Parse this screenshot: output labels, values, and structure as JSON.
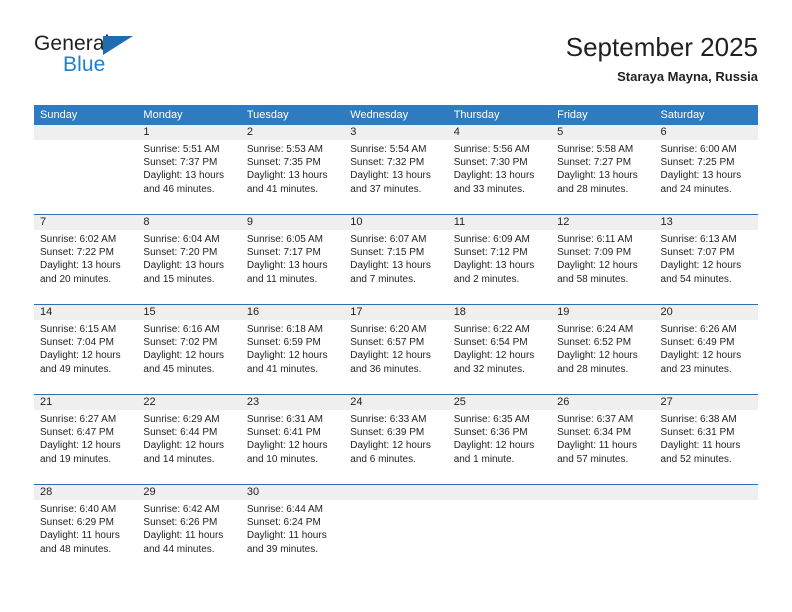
{
  "brand": {
    "name_part1": "General",
    "name_part2": "Blue",
    "flag_icon": "triangle-flag-icon"
  },
  "header": {
    "title": "September 2025",
    "location": "Staraya Mayna, Russia"
  },
  "theme": {
    "header_blue": "#2f7bbf",
    "row_rule_blue": "#2f6fab",
    "daynum_band": "#efefef",
    "brand_blue": "#1f7fd0",
    "text": "#231f20",
    "background": "#ffffff"
  },
  "weekdays": [
    "Sunday",
    "Monday",
    "Tuesday",
    "Wednesday",
    "Thursday",
    "Friday",
    "Saturday"
  ],
  "weeks": [
    [
      {
        "day": "",
        "lines": [
          "",
          "",
          "",
          ""
        ],
        "empty": true
      },
      {
        "day": "1",
        "lines": [
          "Sunrise: 5:51 AM",
          "Sunset: 7:37 PM",
          "Daylight: 13 hours",
          "and 46 minutes."
        ]
      },
      {
        "day": "2",
        "lines": [
          "Sunrise: 5:53 AM",
          "Sunset: 7:35 PM",
          "Daylight: 13 hours",
          "and 41 minutes."
        ]
      },
      {
        "day": "3",
        "lines": [
          "Sunrise: 5:54 AM",
          "Sunset: 7:32 PM",
          "Daylight: 13 hours",
          "and 37 minutes."
        ]
      },
      {
        "day": "4",
        "lines": [
          "Sunrise: 5:56 AM",
          "Sunset: 7:30 PM",
          "Daylight: 13 hours",
          "and 33 minutes."
        ]
      },
      {
        "day": "5",
        "lines": [
          "Sunrise: 5:58 AM",
          "Sunset: 7:27 PM",
          "Daylight: 13 hours",
          "and 28 minutes."
        ]
      },
      {
        "day": "6",
        "lines": [
          "Sunrise: 6:00 AM",
          "Sunset: 7:25 PM",
          "Daylight: 13 hours",
          "and 24 minutes."
        ]
      }
    ],
    [
      {
        "day": "7",
        "lines": [
          "Sunrise: 6:02 AM",
          "Sunset: 7:22 PM",
          "Daylight: 13 hours",
          "and 20 minutes."
        ]
      },
      {
        "day": "8",
        "lines": [
          "Sunrise: 6:04 AM",
          "Sunset: 7:20 PM",
          "Daylight: 13 hours",
          "and 15 minutes."
        ]
      },
      {
        "day": "9",
        "lines": [
          "Sunrise: 6:05 AM",
          "Sunset: 7:17 PM",
          "Daylight: 13 hours",
          "and 11 minutes."
        ]
      },
      {
        "day": "10",
        "lines": [
          "Sunrise: 6:07 AM",
          "Sunset: 7:15 PM",
          "Daylight: 13 hours",
          "and 7 minutes."
        ]
      },
      {
        "day": "11",
        "lines": [
          "Sunrise: 6:09 AM",
          "Sunset: 7:12 PM",
          "Daylight: 13 hours",
          "and 2 minutes."
        ]
      },
      {
        "day": "12",
        "lines": [
          "Sunrise: 6:11 AM",
          "Sunset: 7:09 PM",
          "Daylight: 12 hours",
          "and 58 minutes."
        ]
      },
      {
        "day": "13",
        "lines": [
          "Sunrise: 6:13 AM",
          "Sunset: 7:07 PM",
          "Daylight: 12 hours",
          "and 54 minutes."
        ]
      }
    ],
    [
      {
        "day": "14",
        "lines": [
          "Sunrise: 6:15 AM",
          "Sunset: 7:04 PM",
          "Daylight: 12 hours",
          "and 49 minutes."
        ]
      },
      {
        "day": "15",
        "lines": [
          "Sunrise: 6:16 AM",
          "Sunset: 7:02 PM",
          "Daylight: 12 hours",
          "and 45 minutes."
        ]
      },
      {
        "day": "16",
        "lines": [
          "Sunrise: 6:18 AM",
          "Sunset: 6:59 PM",
          "Daylight: 12 hours",
          "and 41 minutes."
        ]
      },
      {
        "day": "17",
        "lines": [
          "Sunrise: 6:20 AM",
          "Sunset: 6:57 PM",
          "Daylight: 12 hours",
          "and 36 minutes."
        ]
      },
      {
        "day": "18",
        "lines": [
          "Sunrise: 6:22 AM",
          "Sunset: 6:54 PM",
          "Daylight: 12 hours",
          "and 32 minutes."
        ]
      },
      {
        "day": "19",
        "lines": [
          "Sunrise: 6:24 AM",
          "Sunset: 6:52 PM",
          "Daylight: 12 hours",
          "and 28 minutes."
        ]
      },
      {
        "day": "20",
        "lines": [
          "Sunrise: 6:26 AM",
          "Sunset: 6:49 PM",
          "Daylight: 12 hours",
          "and 23 minutes."
        ]
      }
    ],
    [
      {
        "day": "21",
        "lines": [
          "Sunrise: 6:27 AM",
          "Sunset: 6:47 PM",
          "Daylight: 12 hours",
          "and 19 minutes."
        ]
      },
      {
        "day": "22",
        "lines": [
          "Sunrise: 6:29 AM",
          "Sunset: 6:44 PM",
          "Daylight: 12 hours",
          "and 14 minutes."
        ]
      },
      {
        "day": "23",
        "lines": [
          "Sunrise: 6:31 AM",
          "Sunset: 6:41 PM",
          "Daylight: 12 hours",
          "and 10 minutes."
        ]
      },
      {
        "day": "24",
        "lines": [
          "Sunrise: 6:33 AM",
          "Sunset: 6:39 PM",
          "Daylight: 12 hours",
          "and 6 minutes."
        ]
      },
      {
        "day": "25",
        "lines": [
          "Sunrise: 6:35 AM",
          "Sunset: 6:36 PM",
          "Daylight: 12 hours",
          "and 1 minute."
        ]
      },
      {
        "day": "26",
        "lines": [
          "Sunrise: 6:37 AM",
          "Sunset: 6:34 PM",
          "Daylight: 11 hours",
          "and 57 minutes."
        ]
      },
      {
        "day": "27",
        "lines": [
          "Sunrise: 6:38 AM",
          "Sunset: 6:31 PM",
          "Daylight: 11 hours",
          "and 52 minutes."
        ]
      }
    ],
    [
      {
        "day": "28",
        "lines": [
          "Sunrise: 6:40 AM",
          "Sunset: 6:29 PM",
          "Daylight: 11 hours",
          "and 48 minutes."
        ]
      },
      {
        "day": "29",
        "lines": [
          "Sunrise: 6:42 AM",
          "Sunset: 6:26 PM",
          "Daylight: 11 hours",
          "and 44 minutes."
        ]
      },
      {
        "day": "30",
        "lines": [
          "Sunrise: 6:44 AM",
          "Sunset: 6:24 PM",
          "Daylight: 11 hours",
          "and 39 minutes."
        ]
      },
      {
        "day": "",
        "lines": [
          "",
          "",
          "",
          ""
        ],
        "empty": true
      },
      {
        "day": "",
        "lines": [
          "",
          "",
          "",
          ""
        ],
        "empty": true
      },
      {
        "day": "",
        "lines": [
          "",
          "",
          "",
          ""
        ],
        "empty": true
      },
      {
        "day": "",
        "lines": [
          "",
          "",
          "",
          ""
        ],
        "empty": true
      }
    ]
  ]
}
